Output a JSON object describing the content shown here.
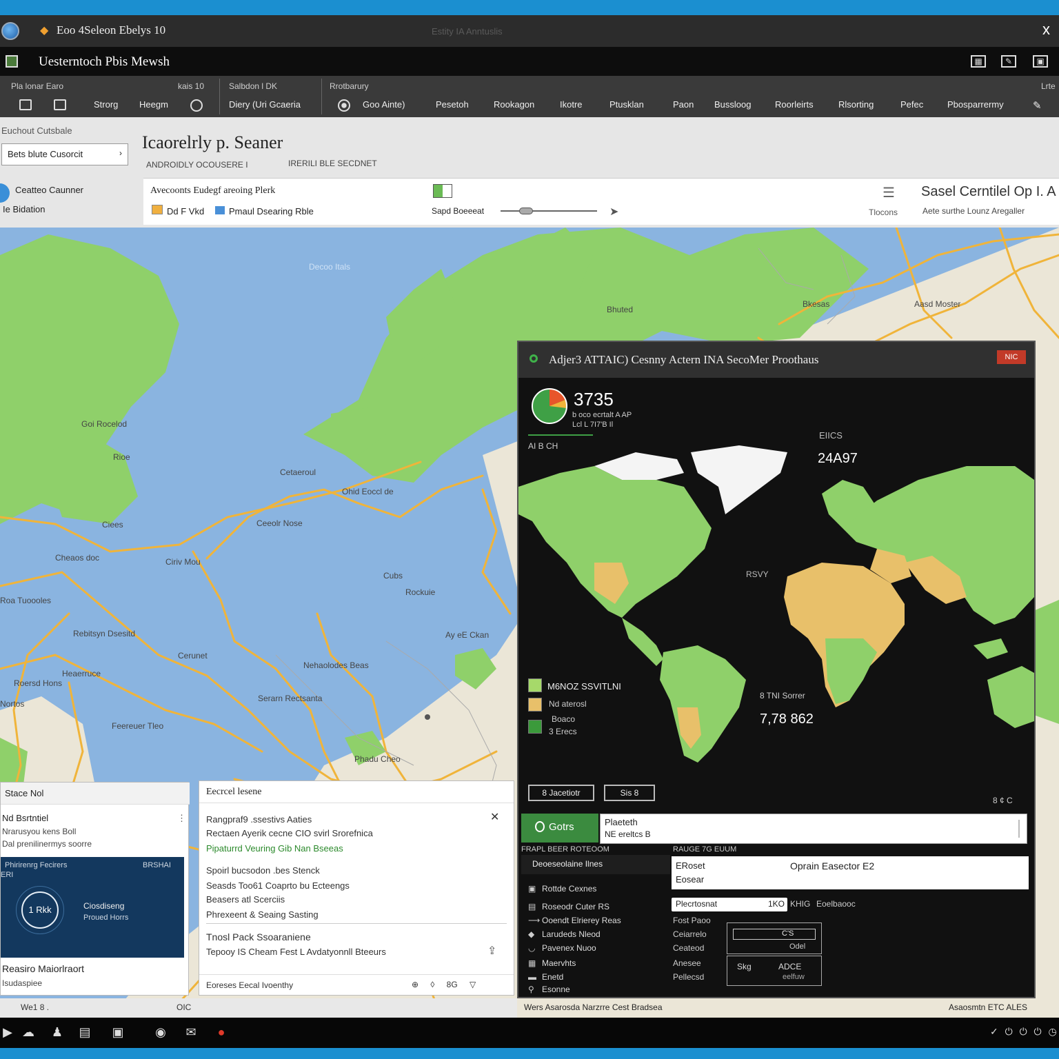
{
  "window": {
    "title": "Eoo 4Seleon Ebelys 10",
    "center_text": "Estity IA Anntuslis",
    "close_glyph": "x"
  },
  "app": {
    "name": "Uesterntoch  Pbis Mewsh"
  },
  "ribbon": {
    "group1_label": "Pla lonar Earo",
    "group2_label": "kais 10",
    "group3_label": "Salbdon l DK",
    "group4_label": "Rrotbarury",
    "corner_label": "Lrte",
    "buttons": [
      "Strorg",
      "Heegm",
      "Diery  (Uri Gcaeria",
      "Goo Ainte)",
      "Pesetoh",
      "Rookagon",
      "Ikotre",
      "Ptusklan",
      "Paon",
      "Bussloog",
      "Roorleirts",
      "Rlsorting",
      "Pefec",
      "Pbosparrermy"
    ]
  },
  "top": {
    "breadcrumb": "Euchout Cutsbale",
    "layer_select": "Bets blute Cusorcit",
    "page_title": "Icaorelrly p. Seaner",
    "subtitle_a": "ANDROIDLY OCOUSERE I",
    "subtitle_b": "IRERILI BLE SECDNET",
    "left_t1": "Ceatteo Caunner",
    "left_t2": "Ie Bidation",
    "route": {
      "line1": "Avecoonts Eudegf areoing Plerk",
      "chip1": "Dd F Vkd",
      "chip2": "Pmaul Dsearing Rble",
      "slider_label": "Sapd Boeeeat",
      "units": "Tlocons",
      "card_title": "Sasel Cerntilel Op I. A",
      "card_sub": "Aete surthe Lounz Aregaller"
    }
  },
  "map": {
    "labels": [
      "Decoo Itals",
      "Bhuted",
      "Bkesas",
      "Aasd Moster",
      "Goi Rocelod",
      "Cetaeroul",
      "Ohid Eoccl de",
      "Rioe",
      "Ciees",
      "Cheaos doc",
      "Ceeolr Nose",
      "Roa Tuoooles",
      "Cubs",
      "Ciriv Mou",
      "Rockuie",
      "Ay eE Ckan",
      "Heaerruce",
      "Rebitsyn Dsesitd",
      "Roersd Hons",
      "Phadu Cheo",
      "Feereuer Tleo",
      "Nehaolodes Beas",
      "Serarn Rectsanta",
      "Nortos",
      "Cerunet"
    ],
    "colors": {
      "water": "#8ab4e0",
      "land_green": "#8fd06a",
      "land_beige": "#ebe6d7",
      "roads": "#f0b43a"
    }
  },
  "analytics": {
    "title": "Adjer3  ATTAIC)  Cesnny Actern INA SecoMer Proothaus",
    "badge": "NIC",
    "kpi1": "3735",
    "kpi1_sub": "b oco ecrtalt A AP",
    "kpi1_sub2": "Lcl L 7I7'B Il",
    "kpi_tri": "AI  B CH",
    "label_right": "EIICS",
    "kpi2": "24A97",
    "label_mid": "RSVY",
    "legend": [
      {
        "label": "M6NOZ  SSVITLNI",
        "color": "#a6d96a"
      },
      {
        "label": "Nd aterosl",
        "color": "#e8c06a"
      },
      {
        "label": "Boaco",
        "color": "#3b9a3b"
      }
    ],
    "legend_extra": "3 Erecs",
    "kpi3_label": "8 TNI Sorrer",
    "kpi3": "7,78 862",
    "btn1": "8 Jacetiotr",
    "btn2": "Sis 8",
    "tools": "8 ¢ C",
    "go_button": "Gotrs",
    "field1_a": "Plaeteth",
    "field1_b": "NE ereltcs B",
    "table_head": "FRAPL BEER ROTEOOM",
    "table_head2": "RAUGE 7G  EUUM",
    "selected_row": "Deoeseolaine Ilnes",
    "card2_a": "ERoset",
    "card2_b": "Eosear",
    "card2_c": "Oprain Easector E2",
    "list": [
      {
        "icon": "▣",
        "label": "Rottde Cexnes"
      },
      {
        "icon": "▤",
        "label": "Roseodr Cuter RS"
      },
      {
        "icon": "⟶",
        "label": "Ooendt Elrierey  Reas"
      },
      {
        "icon": "◆",
        "label": "Larudeds Nleod"
      },
      {
        "icon": "◡",
        "label": "Pavenex Nuoo"
      },
      {
        "icon": "▦",
        "label": "Maervhts"
      },
      {
        "icon": "▬",
        "label": "Enetd"
      },
      {
        "icon": "⚲",
        "label": "Esonne"
      }
    ],
    "pill": "Plecrtosnat",
    "pill_num": "1KO",
    "pill_after": "KHIG",
    "pill_after2": "Eoelbaooc",
    "mini": [
      "Fost Paoo",
      "Ceiarrelo",
      "Ceateod",
      "Anesee",
      "Pellecsd"
    ],
    "box1_val": "C'S",
    "box1_sub": "Odel",
    "box2_a": "Skg",
    "box2_b": "ADCE",
    "box2_c": "eelfuw"
  },
  "strip": {
    "left": "Wers Asarosda Narzrre  Cest Bradsea",
    "right": "Asaosmtn ETC ALES"
  },
  "panelA": {
    "header": "Stace Nol",
    "t1": "Nd Bsrtntiel",
    "t2": "Nrarusyou kens Boll",
    "t3": "Dal prenilinermys soorre",
    "card_a": "Phirirenrg Fecirers",
    "card_b": "BRSHAI",
    "card_c": "ERI",
    "ring": "1 Rkk",
    "card_d": "Ciosdiseng",
    "card_e": "Proued Horrs",
    "t4": "Reasiro Maiorlraort",
    "t5": "Isudaspiee"
  },
  "panelB": {
    "header": "Eecrcel lesene",
    "l1": "Rangpraf9 .ssestivs Aaties",
    "l2": "Rectaen Ayerik cecne CIO svirl Srorefnica",
    "l3": "Pipaturrd Veuring Gib Nan Bseeas",
    "l4": "Spoirl bucsodon .bes Stenck",
    "l5": "Seasds Too61 Coaprto bu Ecteengs",
    "l6": "Beasers atl Scerciis",
    "l7": "Phrexeent & Seaing Sasting",
    "l8": "Tnosl Pack Ssoaraniene",
    "l9": "Tepooy IS  Cheam  Fest  L Avdatyonnll Bteeurs",
    "footer": "Eoreses  Eecal Ivoenthy",
    "footer_icons": "⊕ ◊ 8G ▽"
  },
  "infobar": {
    "left": "We1 8 .",
    "right": "OIC"
  }
}
